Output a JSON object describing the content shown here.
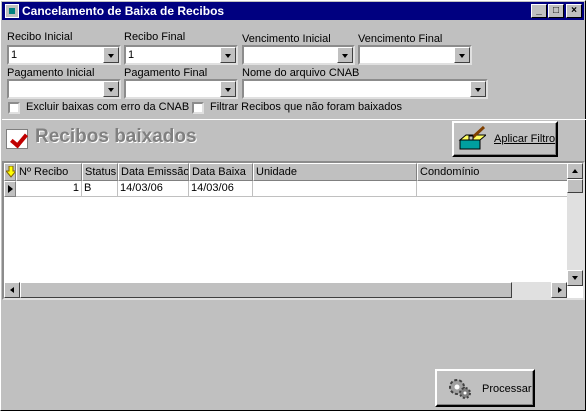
{
  "window": {
    "title": "Cancelamento de Baixa de Recibos",
    "minimize": "_",
    "maximize": "□",
    "close": "×"
  },
  "filters": {
    "recibo_inicial": {
      "label": "Recibo Inicial",
      "value": "1"
    },
    "recibo_final": {
      "label": "Recibo Final",
      "value": "1"
    },
    "vencimento_inicial": {
      "label": "Vencimento Inicial",
      "value": ""
    },
    "vencimento_final": {
      "label": "Vencimento Final",
      "value": ""
    },
    "pagamento_inicial": {
      "label": "Pagamento Inicial",
      "value": ""
    },
    "pagamento_final": {
      "label": "Pagamento Final",
      "value": ""
    },
    "nome_arquivo": {
      "label": "Nome do arquivo CNAB",
      "value": ""
    },
    "excluir_erro": {
      "label": "Excluir baixas com erro da CNAB",
      "checked": false
    },
    "filtrar_nao_baixados": {
      "label": "Filtrar Recibos que não foram baixados",
      "checked": false
    }
  },
  "section": {
    "title": "Recibos baixados"
  },
  "apply_button": {
    "label": "Aplicar Filtro"
  },
  "grid": {
    "columns": [
      "Nº Recibo",
      "Status",
      "Data Emissão",
      "Data Baixa",
      "Unidade",
      "Condomínio"
    ],
    "rows": [
      {
        "recibo": "1",
        "status": "B",
        "emissao": "14/03/06",
        "baixa": "14/03/06",
        "unidade": "",
        "condominio": ""
      }
    ]
  },
  "process_button": {
    "label": "Processar"
  },
  "colors": {
    "titlebar": "#000080",
    "face": "#c0c0c0",
    "checkmark": "#c00000"
  }
}
